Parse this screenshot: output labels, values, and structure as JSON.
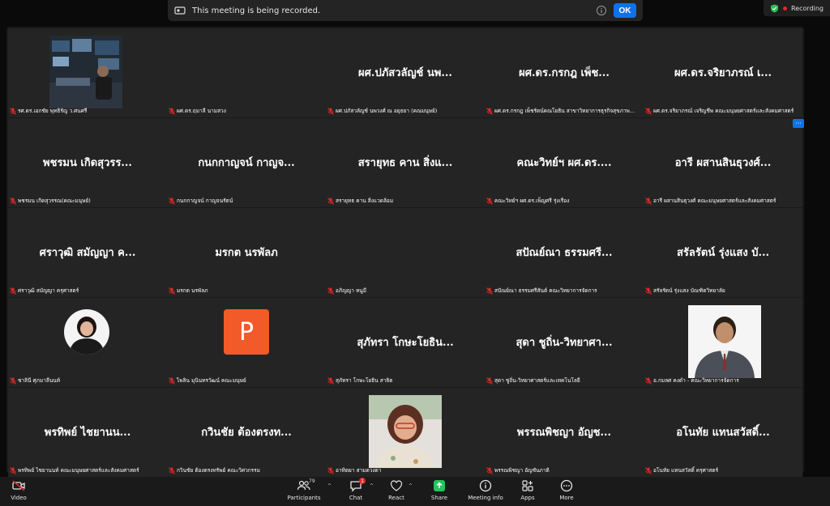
{
  "banner": {
    "message": "This meeting is being recorded.",
    "ok_label": "OK"
  },
  "status": {
    "recording_label": "Recording"
  },
  "participants": [
    {
      "name_big": "",
      "label": "รศ.ดร.เอกชัย พุทธิรัญ ว.ศนศรี",
      "media": "photo-studio"
    },
    {
      "name_big": "",
      "label": "ผศ.ดร.ฤมาลี นามสวง",
      "media": "photo-woman1"
    },
    {
      "name_big": "ผศ.ปภัสวลัญช์ นพ...",
      "label": "ผศ.ปภัสวลัญช์ นพวงศ์ ณ อยุธยา (คณมนุษย์)",
      "media": ""
    },
    {
      "name_big": "ผศ.ดร.กรกฎ เพ็ช...",
      "label": "ผศ.ดร.กรกฎ เพ็ชรัตน์คณโยธิน สาขาวิทยาการธุรกิจสุขภาพ...",
      "media": ""
    },
    {
      "name_big": "ผศ.ดร.จริยาภรณ์ เ...",
      "label": "ผศ.ดร.จริยาภรณ์ เจริญชีพ คณะมนุษยศาสตร์และสังคมศาสตร์",
      "media": ""
    },
    {
      "name_big": "พชรมน เกิดสุวรร...",
      "label": "พชรมน เกิดสุวรรณ(คณะมนุษย์)",
      "media": ""
    },
    {
      "name_big": "กนกกาญจน์ กาญจ...",
      "label": "กนกกาญจน์ กาญจนรัตน์",
      "media": ""
    },
    {
      "name_big": "สรายุทธ คาน สิ่งแ...",
      "label": "สรายุทธ คาน สิ่งแวดล้อม",
      "media": ""
    },
    {
      "name_big": "คณะวิทย์ฯ ผศ.ดร....",
      "label": "คณะวิทย์ฯ ผศ.ดร.เพ็ญศรี รุ่งเรือง",
      "media": ""
    },
    {
      "name_big": "อารี ผสานสินธุวงศ์...",
      "label": "อารี ผสานสินธุวงศ์ คณะมนุษยศาสตร์และสังคมศาสตร์",
      "media": ""
    },
    {
      "name_big": "ศราวุฒิ สมัญญา ค...",
      "label": "ศราวุฒิ สมัญญา ครุศาสตร์",
      "media": ""
    },
    {
      "name_big": "มรกต นรพัลภ",
      "label": "มรกต นรพัลภ",
      "media": ""
    },
    {
      "name_big": "",
      "label": "อภิญญา หนูมี",
      "media": "photo-mask"
    },
    {
      "name_big": "สปัณย์ณา ธรรมศรี...",
      "label": "สปัณย์ณา ธรรมศรีสันต์ คณะวิทยาการจัดการ",
      "media": ""
    },
    {
      "name_big": "สรัลรัตน์ รุ่งแสง บั...",
      "label": "สรัลรัตน์ รุ่งแสง บัณฑิตวิทยาลัย",
      "media": ""
    },
    {
      "name_big": "",
      "label": "ชาลินี ศุภมาลีนนท์",
      "media": "photo-woman2"
    },
    {
      "name_big": "",
      "label": "ไพลิน มุนินทรวัฒน์ คณะมนุษย์",
      "media": "avatar-p",
      "avatar_letter": "P"
    },
    {
      "name_big": "สุภัทรา โกษะโยธิน...",
      "label": "สุภัทรา โกษะโยธิน สาธิต",
      "media": ""
    },
    {
      "name_big": "สุดา ชูถิ่น-วิทยาศา...",
      "label": "สุดา ชูถิ่น-วิทยาศาสตร์และเทคโนโลยี",
      "media": ""
    },
    {
      "name_big": "",
      "label": "อ.กมลศ คงดำ - คณะวิทยาการจัดการ",
      "media": "photo-man"
    },
    {
      "name_big": "พรทิพย์  ไชยานน...",
      "label": "พรทิพย์  ไชยานนท์ คณะมนุษยศาสตร์และสังคมศาสตร์",
      "media": ""
    },
    {
      "name_big": "กวินชัย ต้องตรงท...",
      "label": "กวินชัย ต้องตรงทรัพย์ คณะวิศวกรรม",
      "media": ""
    },
    {
      "name_big": "",
      "label": "อาทิตยา สามดวงดา",
      "media": "photo-woman3"
    },
    {
      "name_big": "พรรณพิชญา อัญช...",
      "label": "พรรณพิชญา อัญชันภาติ",
      "media": ""
    },
    {
      "name_big": "อโนทัย แทนสวัสดิ์...",
      "label": "อโนทัย แทนสวัสดิ์ ครุศาสตร์",
      "media": ""
    }
  ],
  "toolbar": {
    "video": "Video",
    "participants": "Participants",
    "participants_count": "79",
    "chat": "Chat",
    "chat_badge": "1",
    "react": "React",
    "share": "Share",
    "meeting_info": "Meeting info",
    "apps": "Apps",
    "more": "More"
  },
  "colors": {
    "accent": "#0e72ed",
    "muted_red": "#e02828",
    "share_green": "#22c55e",
    "avatar_orange": "#f25a29"
  }
}
